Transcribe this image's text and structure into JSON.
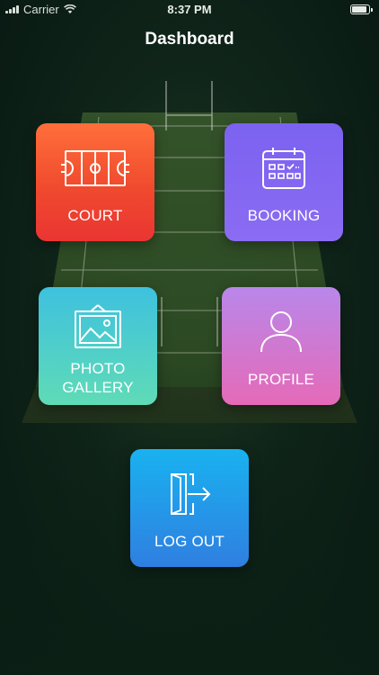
{
  "status_bar": {
    "carrier": "Carrier",
    "time": "8:37 PM"
  },
  "header": {
    "title": "Dashboard"
  },
  "tiles": [
    {
      "label": "COURT",
      "icon": "court-icon"
    },
    {
      "label": "BOOKING",
      "icon": "calendar-icon"
    },
    {
      "label": "PHOTO\nGALLERY",
      "icon": "photo-frame-icon"
    },
    {
      "label": "PROFILE",
      "icon": "user-icon"
    },
    {
      "label": "LOG OUT",
      "icon": "logout-icon"
    }
  ],
  "colors": {
    "court": "#f04a2e",
    "booking": "#7b62f0",
    "gallery": "#4fcfcb",
    "profile": "#d27ad0",
    "logout": "#2696e8"
  }
}
